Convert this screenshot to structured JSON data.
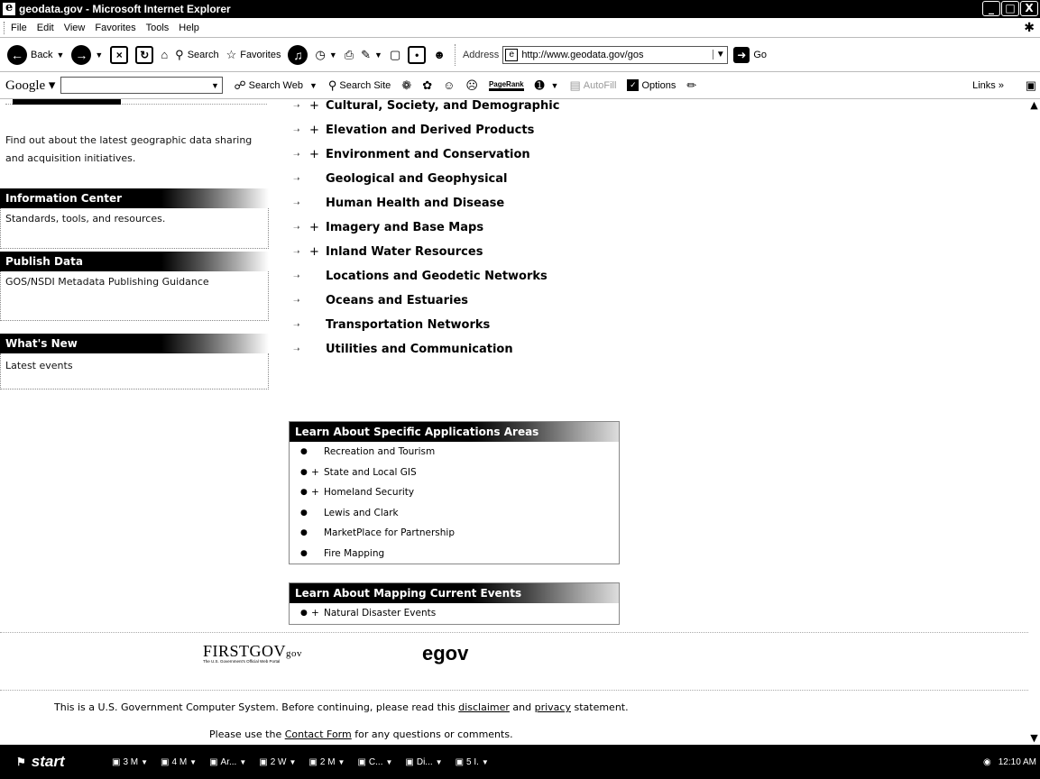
{
  "window": {
    "title": "geodata.gov - Microsoft Internet Explorer",
    "buttons": [
      "_",
      "□",
      "X"
    ]
  },
  "menu": [
    "File",
    "Edit",
    "View",
    "Favorites",
    "Tools",
    "Help"
  ],
  "toolbar": {
    "back_label": "Back",
    "search_label": "Search",
    "favorites_label": "Favorites",
    "address_label": "Address",
    "address_value": "http://www.geodata.gov/gos",
    "go_label": "Go"
  },
  "google_toolbar": {
    "logo": "Google",
    "search_web": "Search Web",
    "search_site": "Search Site",
    "pagerank": "PageRank",
    "autofill": "AutoFill",
    "options": "Options",
    "links": "Links"
  },
  "sidebar": {
    "top_text": "Find out about the latest geographic data sharing and acquisition initiatives.",
    "sections": [
      {
        "title": "Information Center",
        "text": "Standards, tools, and resources."
      },
      {
        "title": "Publish Data",
        "text": "GOS/NSDI Metadata Publishing Guidance"
      },
      {
        "title": "What's New",
        "text": "Latest events"
      }
    ]
  },
  "categories": [
    {
      "label": "Cultural, Society, and Demographic",
      "plus": "+"
    },
    {
      "label": "Elevation and Derived Products",
      "plus": "+"
    },
    {
      "label": "Environment and Conservation",
      "plus": "+"
    },
    {
      "label": "Geological and Geophysical",
      "plus": ""
    },
    {
      "label": "Human Health and Disease",
      "plus": ""
    },
    {
      "label": "Imagery and Base Maps",
      "plus": "+"
    },
    {
      "label": "Inland Water Resources",
      "plus": "+"
    },
    {
      "label": "Locations and Geodetic Networks",
      "plus": ""
    },
    {
      "label": "Oceans and Estuaries",
      "plus": ""
    },
    {
      "label": "Transportation Networks",
      "plus": ""
    },
    {
      "label": "Utilities and Communication",
      "plus": ""
    }
  ],
  "applications": {
    "title": "Learn About Specific Applications Areas",
    "items": [
      {
        "label": "Recreation and Tourism",
        "plus": ""
      },
      {
        "label": "State and Local GIS",
        "plus": "+"
      },
      {
        "label": "Homeland Security",
        "plus": "+"
      },
      {
        "label": "Lewis and Clark",
        "plus": ""
      },
      {
        "label": "MarketPlace for Partnership",
        "plus": ""
      },
      {
        "label": "Fire Mapping",
        "plus": ""
      }
    ]
  },
  "current_events": {
    "title": "Learn About Mapping Current Events",
    "items": [
      {
        "label": "Natural Disaster Events",
        "plus": "+"
      }
    ]
  },
  "footer": {
    "firstgov": "FIRSTGOV",
    "firstgov_suffix": "gov",
    "firstgov_sub": "The U.S. Government's Official Web Portal",
    "egov": "egov",
    "line1_pre": "This is a U.S. Government Computer System. Before continuing, please read this ",
    "disclaimer": "disclaimer",
    "line1_mid": " and ",
    "privacy": "privacy",
    "line1_post": " statement.",
    "line2_pre": "Please use the ",
    "contact": "Contact Form",
    "line2_post": " for any questions or comments."
  },
  "taskbar": {
    "start": "start",
    "tasks": [
      "3 M",
      "4 M",
      "Ar...",
      "2 W",
      "2 M",
      "C...",
      "Di...",
      "5 I."
    ],
    "clock": "12:10 AM"
  }
}
